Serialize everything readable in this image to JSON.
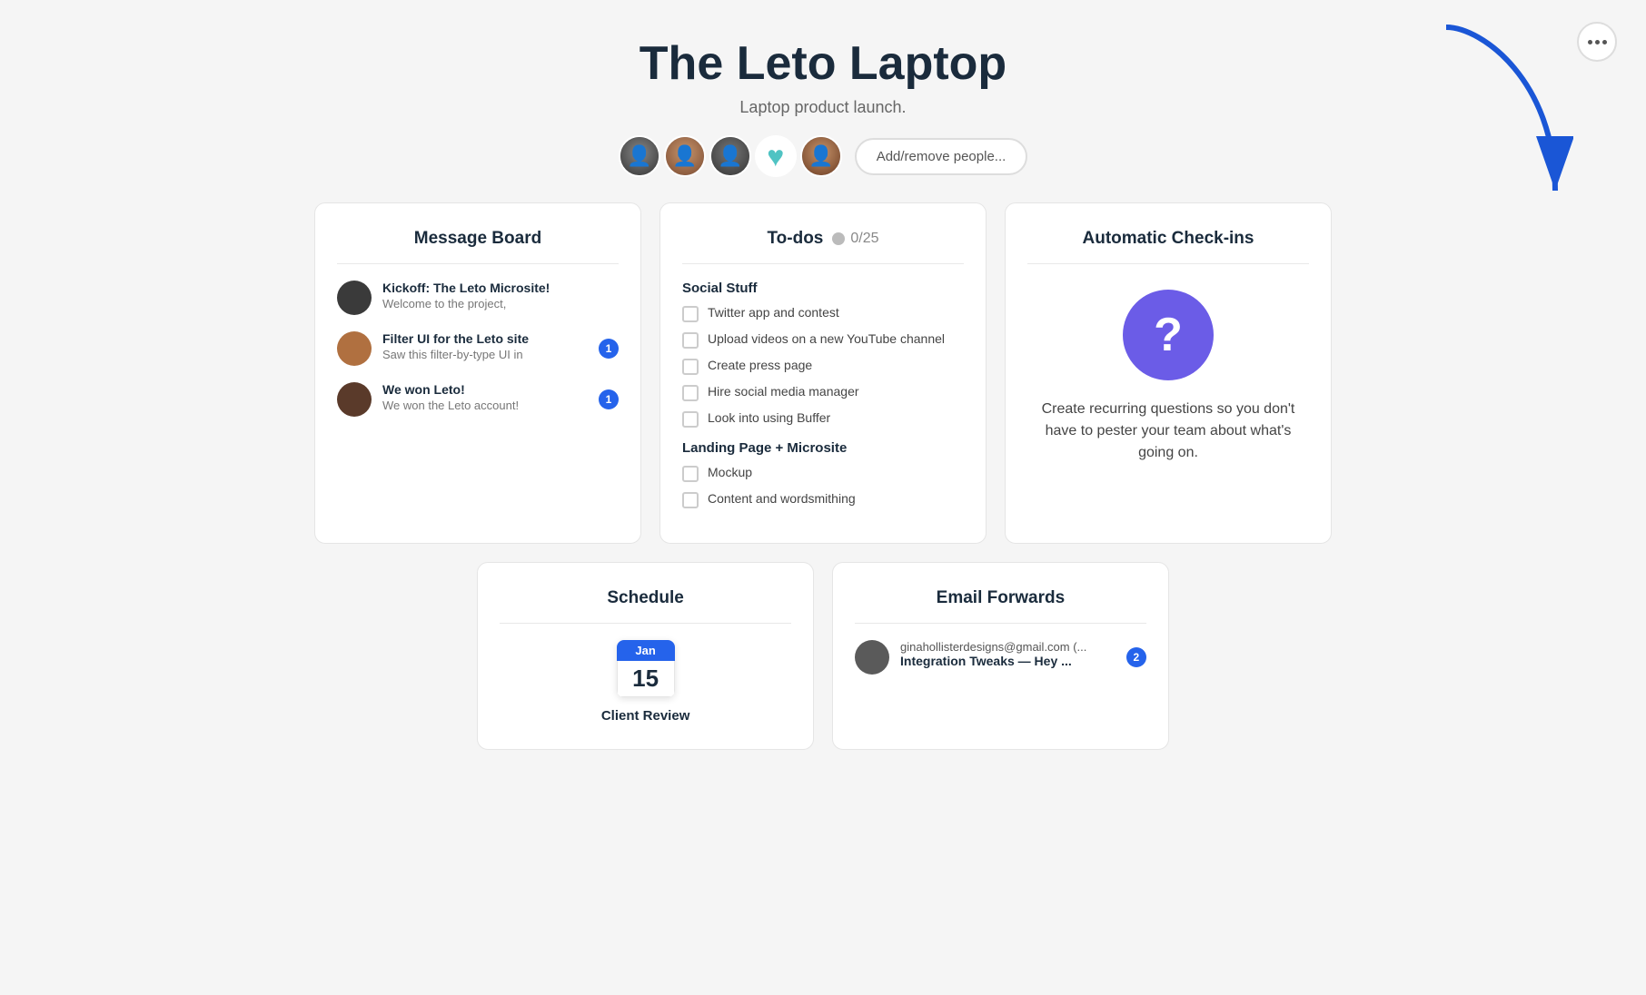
{
  "header": {
    "title": "The Leto Laptop",
    "subtitle": "Laptop product launch.",
    "add_people_label": "Add/remove people..."
  },
  "menu": {
    "dots": "···"
  },
  "message_board": {
    "title": "Message Board",
    "messages": [
      {
        "title": "Kickoff: The Leto Microsite!",
        "preview": "Welcome to the project,",
        "badge": null,
        "av_color": "#3a3a3a"
      },
      {
        "title": "Filter UI for the Leto site",
        "preview": "Saw this filter-by-type UI in",
        "badge": "1",
        "av_color": "#b07040"
      },
      {
        "title": "We won Leto!",
        "preview": "We won the Leto account!",
        "badge": "1",
        "av_color": "#5a3a2a"
      }
    ]
  },
  "todos": {
    "title": "To-dos",
    "count_label": "0/25",
    "sections": [
      {
        "title": "Social Stuff",
        "items": [
          "Twitter app and contest",
          "Upload videos on a new YouTube channel",
          "Create press page",
          "Hire social media manager",
          "Look into using Buffer"
        ]
      },
      {
        "title": "Landing Page + Microsite",
        "items": [
          "Mockup",
          "Content and wordsmithing"
        ]
      }
    ]
  },
  "checkins": {
    "title": "Automatic Check-ins",
    "question_mark": "?",
    "description": "Create recurring questions so you don't have to pester your team about what's going on."
  },
  "schedule": {
    "title": "Schedule",
    "month": "Jan",
    "day": "15",
    "event_title": "Client Review"
  },
  "email_forwards": {
    "title": "Email Forwards",
    "items": [
      {
        "from": "ginahollisterdesigns@gmail.com (...",
        "subject_bold": "Integration Tweaks",
        "subject_rest": " — Hey ...",
        "badge": "2"
      }
    ]
  }
}
